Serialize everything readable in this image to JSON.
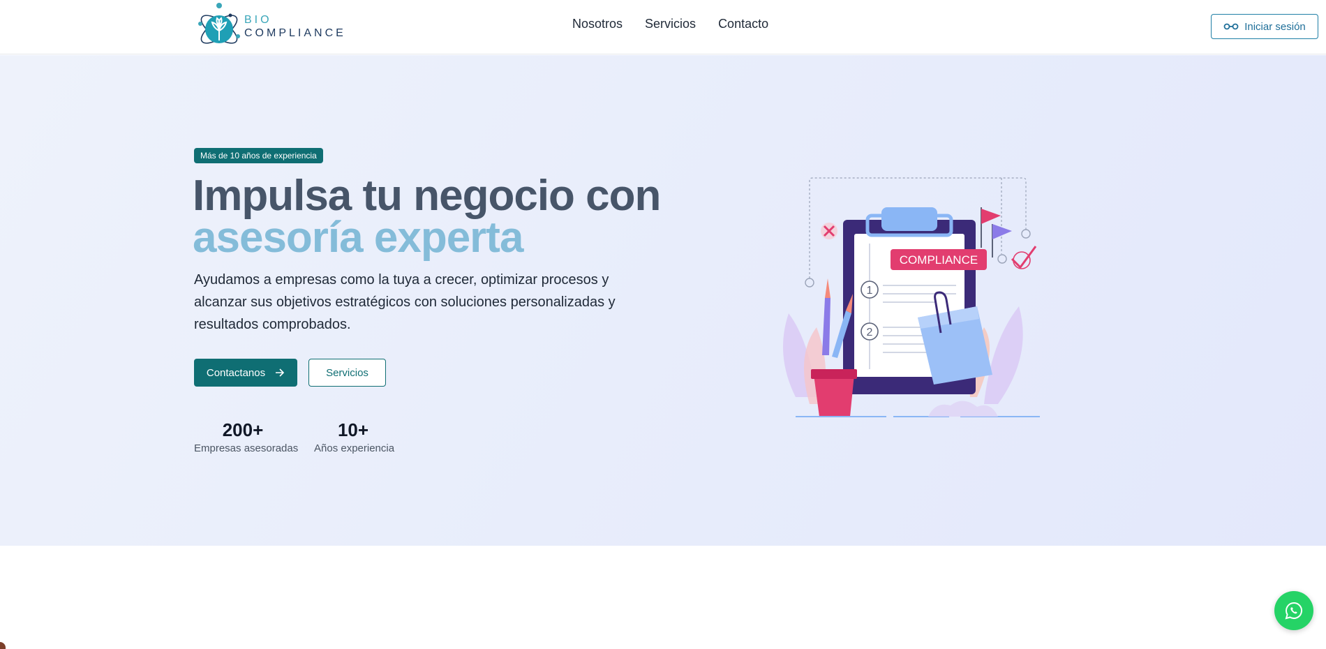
{
  "header": {
    "logo_bio": "BIO",
    "logo_compliance": "COMPLIANCE",
    "nav": [
      {
        "label": "Nosotros"
      },
      {
        "label": "Servicios"
      },
      {
        "label": "Contacto"
      }
    ],
    "login_label": "Iniciar sesión"
  },
  "hero": {
    "badge": "Más de 10 años de experiencia",
    "title_line1": "Impulsa tu negocio con",
    "title_line2": "asesoría experta",
    "subtitle": "Ayudamos a empresas como la tuya a crecer, optimizar procesos y alcanzar sus objetivos estratégicos con soluciones personalizadas y resultados comprobados.",
    "primary_button": "Contactanos",
    "secondary_button": "Servicios",
    "stats": [
      {
        "value": "200+",
        "label": "Empresas asesoradas"
      },
      {
        "value": "10+",
        "label": "Años experiencia"
      }
    ],
    "illustration": {
      "label": "COMPLIANCE",
      "step1": "1",
      "step2": "2"
    }
  },
  "colors": {
    "primary": "#0f6e73",
    "accent_light": "#84bcd9",
    "title_dark": "#475569",
    "whatsapp": "#25d366"
  },
  "icons": {
    "login": "user-link-icon",
    "arrow": "arrow-right-icon",
    "whatsapp": "whatsapp-icon"
  }
}
